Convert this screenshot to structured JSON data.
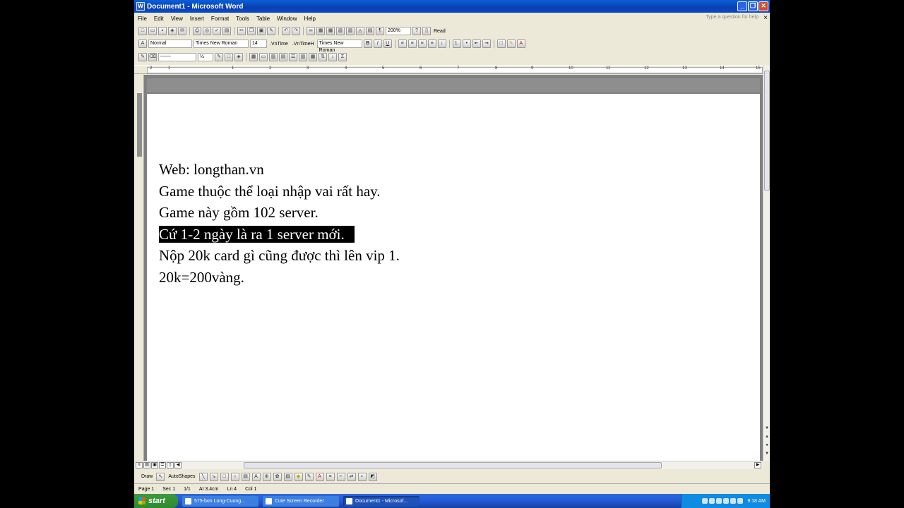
{
  "window": {
    "title": "Document1 - Microsoft Word"
  },
  "menubar": {
    "items": [
      "File",
      "Edit",
      "View",
      "Insert",
      "Format",
      "Tools",
      "Table",
      "Window",
      "Help"
    ],
    "help_placeholder": "Type a question for help"
  },
  "toolbar_standard": {
    "zoom": "200%",
    "read_label": "Read"
  },
  "toolbar_formatting": {
    "style": "Normal",
    "font": "Times New Roman",
    "size": "14",
    "font_vn1": ".VnTime",
    "font_vn2": ".VnTimeH",
    "font_tnr": "Times New Roman",
    "bold": "B",
    "italic": "I",
    "underline": "U"
  },
  "ruler": {
    "marks": [
      "1",
      "2",
      "1",
      "2",
      "3",
      "4",
      "5",
      "6",
      "7",
      "8",
      "9",
      "10",
      "11",
      "12",
      "13",
      "14",
      "15"
    ]
  },
  "document": {
    "lines": [
      "Web: longthan.vn",
      "Game thuộc thể loại nhập vai rất hay.",
      "Game này gồm 102 server.",
      "Cứ 1-2 ngày là ra 1 server mới.",
      "Nộp 20k card gì cũng được thì lên vip 1.",
      "20k=200vàng."
    ],
    "selected_line_index": 3
  },
  "drawbar": {
    "draw_label": "Draw",
    "autoshapes_label": "AutoShapes"
  },
  "statusbar": {
    "page": "Page 1",
    "sec": "Sec 1",
    "pages": "1/1",
    "at": "At 3.4cm",
    "ln": "Ln 4",
    "col": "Col 1"
  },
  "taskbar": {
    "start_label": "start",
    "tasks": [
      "575-bon Long-Cuong...",
      "Cute Screen Recorder",
      "Document1 - Microsof..."
    ],
    "active_task_index": 2,
    "clock": "9:18 AM"
  }
}
